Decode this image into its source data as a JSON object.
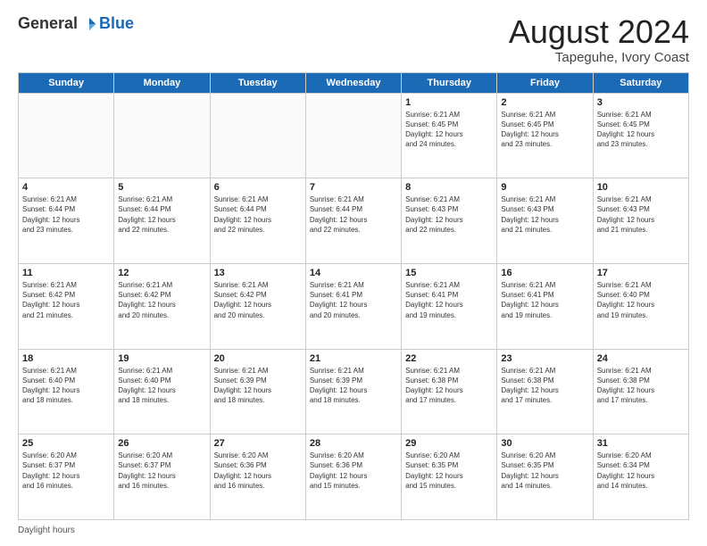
{
  "header": {
    "logo_general": "General",
    "logo_blue": "Blue",
    "month_year": "August 2024",
    "location": "Tapeguhe, Ivory Coast"
  },
  "footer": {
    "daylight_label": "Daylight hours"
  },
  "days_of_week": [
    "Sunday",
    "Monday",
    "Tuesday",
    "Wednesday",
    "Thursday",
    "Friday",
    "Saturday"
  ],
  "weeks": [
    [
      {
        "num": "",
        "info": ""
      },
      {
        "num": "",
        "info": ""
      },
      {
        "num": "",
        "info": ""
      },
      {
        "num": "",
        "info": ""
      },
      {
        "num": "1",
        "info": "Sunrise: 6:21 AM\nSunset: 6:45 PM\nDaylight: 12 hours\nand 24 minutes."
      },
      {
        "num": "2",
        "info": "Sunrise: 6:21 AM\nSunset: 6:45 PM\nDaylight: 12 hours\nand 23 minutes."
      },
      {
        "num": "3",
        "info": "Sunrise: 6:21 AM\nSunset: 6:45 PM\nDaylight: 12 hours\nand 23 minutes."
      }
    ],
    [
      {
        "num": "4",
        "info": "Sunrise: 6:21 AM\nSunset: 6:44 PM\nDaylight: 12 hours\nand 23 minutes."
      },
      {
        "num": "5",
        "info": "Sunrise: 6:21 AM\nSunset: 6:44 PM\nDaylight: 12 hours\nand 22 minutes."
      },
      {
        "num": "6",
        "info": "Sunrise: 6:21 AM\nSunset: 6:44 PM\nDaylight: 12 hours\nand 22 minutes."
      },
      {
        "num": "7",
        "info": "Sunrise: 6:21 AM\nSunset: 6:44 PM\nDaylight: 12 hours\nand 22 minutes."
      },
      {
        "num": "8",
        "info": "Sunrise: 6:21 AM\nSunset: 6:43 PM\nDaylight: 12 hours\nand 22 minutes."
      },
      {
        "num": "9",
        "info": "Sunrise: 6:21 AM\nSunset: 6:43 PM\nDaylight: 12 hours\nand 21 minutes."
      },
      {
        "num": "10",
        "info": "Sunrise: 6:21 AM\nSunset: 6:43 PM\nDaylight: 12 hours\nand 21 minutes."
      }
    ],
    [
      {
        "num": "11",
        "info": "Sunrise: 6:21 AM\nSunset: 6:42 PM\nDaylight: 12 hours\nand 21 minutes."
      },
      {
        "num": "12",
        "info": "Sunrise: 6:21 AM\nSunset: 6:42 PM\nDaylight: 12 hours\nand 20 minutes."
      },
      {
        "num": "13",
        "info": "Sunrise: 6:21 AM\nSunset: 6:42 PM\nDaylight: 12 hours\nand 20 minutes."
      },
      {
        "num": "14",
        "info": "Sunrise: 6:21 AM\nSunset: 6:41 PM\nDaylight: 12 hours\nand 20 minutes."
      },
      {
        "num": "15",
        "info": "Sunrise: 6:21 AM\nSunset: 6:41 PM\nDaylight: 12 hours\nand 19 minutes."
      },
      {
        "num": "16",
        "info": "Sunrise: 6:21 AM\nSunset: 6:41 PM\nDaylight: 12 hours\nand 19 minutes."
      },
      {
        "num": "17",
        "info": "Sunrise: 6:21 AM\nSunset: 6:40 PM\nDaylight: 12 hours\nand 19 minutes."
      }
    ],
    [
      {
        "num": "18",
        "info": "Sunrise: 6:21 AM\nSunset: 6:40 PM\nDaylight: 12 hours\nand 18 minutes."
      },
      {
        "num": "19",
        "info": "Sunrise: 6:21 AM\nSunset: 6:40 PM\nDaylight: 12 hours\nand 18 minutes."
      },
      {
        "num": "20",
        "info": "Sunrise: 6:21 AM\nSunset: 6:39 PM\nDaylight: 12 hours\nand 18 minutes."
      },
      {
        "num": "21",
        "info": "Sunrise: 6:21 AM\nSunset: 6:39 PM\nDaylight: 12 hours\nand 18 minutes."
      },
      {
        "num": "22",
        "info": "Sunrise: 6:21 AM\nSunset: 6:38 PM\nDaylight: 12 hours\nand 17 minutes."
      },
      {
        "num": "23",
        "info": "Sunrise: 6:21 AM\nSunset: 6:38 PM\nDaylight: 12 hours\nand 17 minutes."
      },
      {
        "num": "24",
        "info": "Sunrise: 6:21 AM\nSunset: 6:38 PM\nDaylight: 12 hours\nand 17 minutes."
      }
    ],
    [
      {
        "num": "25",
        "info": "Sunrise: 6:20 AM\nSunset: 6:37 PM\nDaylight: 12 hours\nand 16 minutes."
      },
      {
        "num": "26",
        "info": "Sunrise: 6:20 AM\nSunset: 6:37 PM\nDaylight: 12 hours\nand 16 minutes."
      },
      {
        "num": "27",
        "info": "Sunrise: 6:20 AM\nSunset: 6:36 PM\nDaylight: 12 hours\nand 16 minutes."
      },
      {
        "num": "28",
        "info": "Sunrise: 6:20 AM\nSunset: 6:36 PM\nDaylight: 12 hours\nand 15 minutes."
      },
      {
        "num": "29",
        "info": "Sunrise: 6:20 AM\nSunset: 6:35 PM\nDaylight: 12 hours\nand 15 minutes."
      },
      {
        "num": "30",
        "info": "Sunrise: 6:20 AM\nSunset: 6:35 PM\nDaylight: 12 hours\nand 14 minutes."
      },
      {
        "num": "31",
        "info": "Sunrise: 6:20 AM\nSunset: 6:34 PM\nDaylight: 12 hours\nand 14 minutes."
      }
    ]
  ]
}
